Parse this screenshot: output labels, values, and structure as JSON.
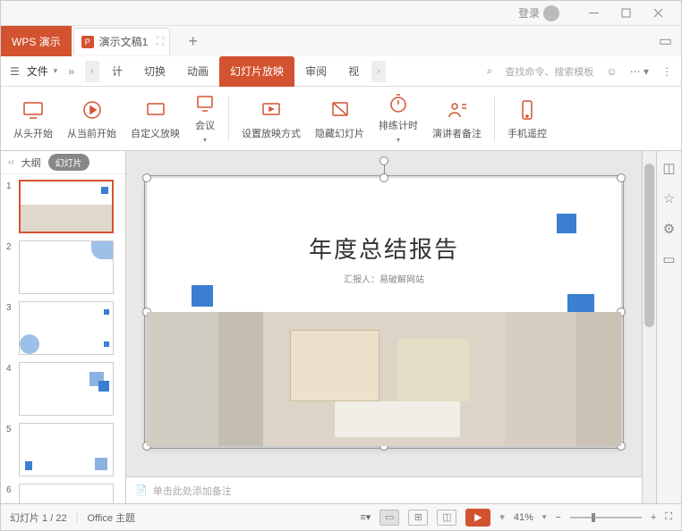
{
  "titlebar": {
    "login": "登录"
  },
  "tabbar": {
    "appName": "WPS 演示",
    "docName": "演示文稿1"
  },
  "menu": {
    "file": "文件",
    "tabs": [
      "计",
      "切换",
      "动画",
      "幻灯片放映",
      "审阅",
      "视"
    ],
    "search": "查找命令、搜索模板"
  },
  "ribbon": {
    "fromStart": "从头开始",
    "fromCurrent": "从当前开始",
    "custom": "自定义放映",
    "meeting": "会议",
    "setup": "设置放映方式",
    "hide": "隐藏幻灯片",
    "rehearse": "排练计时",
    "speaker": "演讲者备注",
    "remote": "手机遥控"
  },
  "thumbs": {
    "outline": "大纲",
    "slides": "幻灯片",
    "count": 6
  },
  "slide": {
    "title": "年度总结报告",
    "subtitle": "汇报人：易破解网站"
  },
  "notes": {
    "placeholder": "单击此处添加备注"
  },
  "status": {
    "slide": "幻灯片 1 / 22",
    "theme": "Office 主题",
    "zoom": "41%"
  }
}
